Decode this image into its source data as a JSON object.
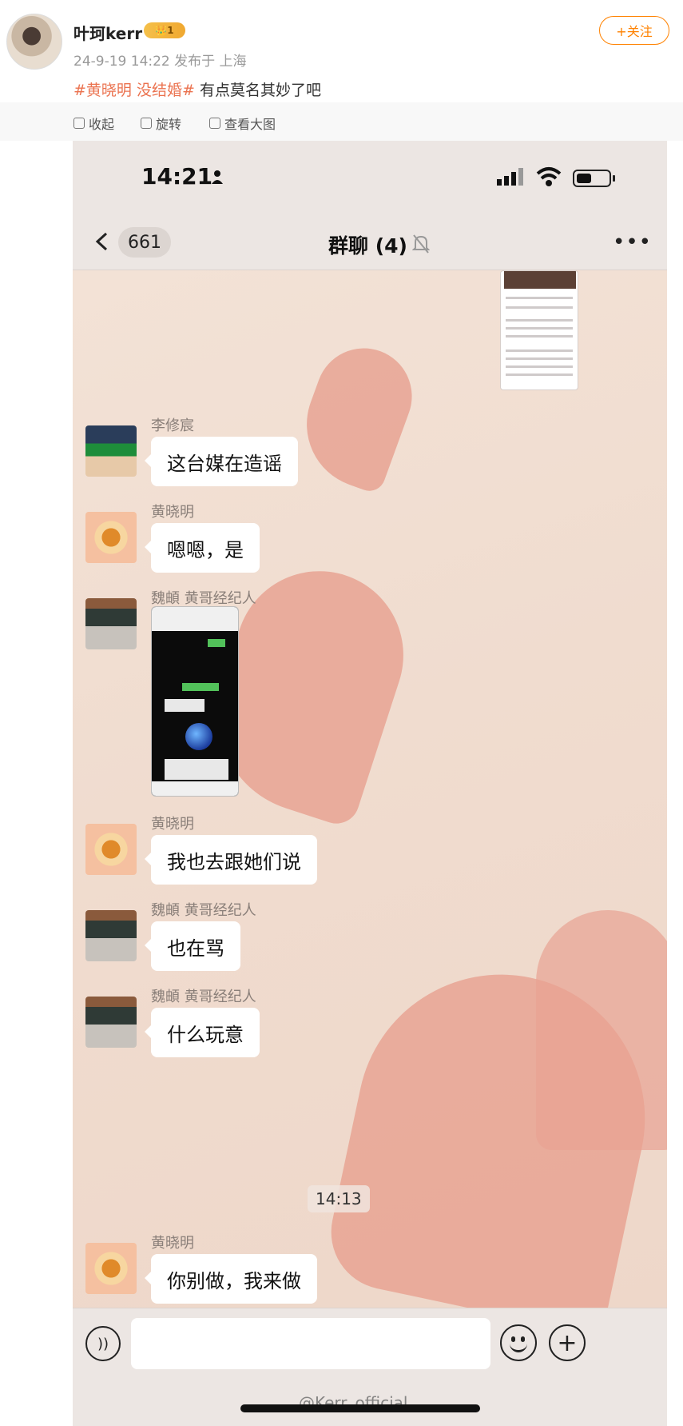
{
  "post": {
    "author": "叶珂kerr",
    "vip_level": "1",
    "meta": "24-9-19 14:22 发布于 上海",
    "follow_label": "+关注",
    "hashtags": [
      "#黄晓明 没结婚#"
    ],
    "text": "有点莫名其妙了吧"
  },
  "toolbar": {
    "items": [
      {
        "label": "收起",
        "icon": "collapse-icon"
      },
      {
        "label": "旋转",
        "icon": "rotate-icon"
      },
      {
        "label": "查看大图",
        "icon": "enlarge-icon"
      }
    ]
  },
  "phone": {
    "status_time": "14:21",
    "back_count": "661",
    "chat_title": "群聊 (4)",
    "timestamp": "14:13",
    "watermark": "@Kerr_official",
    "messages": [
      {
        "sender": "李修宸",
        "text": "这台媒在造谣"
      },
      {
        "sender": "黄晓明",
        "text": "嗯嗯，是"
      },
      {
        "sender": "魏頔 黄哥经纪人",
        "text": ""
      },
      {
        "sender": "黄晓明",
        "text": "我也去跟她们说"
      },
      {
        "sender": "魏頔 黄哥经纪人",
        "text": "也在骂"
      },
      {
        "sender": "魏頔 黄哥经纪人",
        "text": "什么玩意"
      },
      {
        "sender": "黄晓明",
        "text": "你别做，我来做"
      }
    ]
  },
  "colors": {
    "accent": "#eb7350",
    "follow": "#ff8200",
    "chat_bg": "#f0dfd3",
    "heart": "#e8a393"
  }
}
